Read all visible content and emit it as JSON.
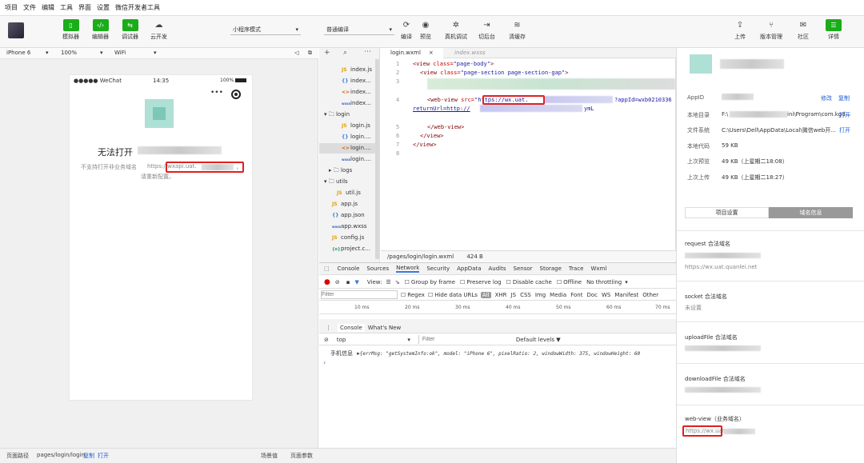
{
  "menu": [
    "项目",
    "文件",
    "编辑",
    "工具",
    "界面",
    "设置",
    "微信开发者工具"
  ],
  "toolbar": {
    "simulator": "模拟器",
    "editor": "编辑器",
    "debugger": "调试器",
    "cloud": "云开发",
    "mode_select": "小程序模式",
    "compile_select": "普通编译",
    "compile": "编译",
    "preview": "预览",
    "real_debug": "真机调试",
    "background": "切后台",
    "clear_cache": "清缓存",
    "upload": "上传",
    "version": "版本管理",
    "community": "社区",
    "details": "详情"
  },
  "simbar": {
    "device": "iPhone 6",
    "zoom": "100%",
    "network": "WiFi"
  },
  "phone": {
    "carrier": "●●●●● WeChat",
    "time": "14:35",
    "battery": "100%",
    "more": "•••",
    "error_title": "无法打开",
    "error_msg": "不支持打开非业务域名",
    "error_url": "https://wxapi.uat.",
    "error_suffix": "，",
    "error_tail": "请重新配置。"
  },
  "tree": {
    "items": [
      {
        "icon": "JS",
        "label": "index.js"
      },
      {
        "icon": "{}",
        "label": "index..."
      },
      {
        "icon": "<>",
        "label": "index..."
      },
      {
        "icon": "wxss",
        "label": "index..."
      },
      {
        "icon": "folder",
        "label": "login"
      },
      {
        "icon": "JS",
        "label": "login.js"
      },
      {
        "icon": "{}",
        "label": "login...."
      },
      {
        "icon": "<>",
        "label": "login...."
      },
      {
        "icon": "wxss",
        "label": "login...."
      },
      {
        "icon": "folder",
        "label": "logs"
      },
      {
        "icon": "folder",
        "label": "utils"
      },
      {
        "icon": "JS",
        "label": "util.js"
      },
      {
        "icon": "JS",
        "label": "app.js"
      },
      {
        "icon": "{}",
        "label": "app.json"
      },
      {
        "icon": "wxss",
        "label": "app.wxss"
      },
      {
        "icon": "JS",
        "label": "config.js"
      },
      {
        "icon": "{o}",
        "label": "project.c..."
      }
    ]
  },
  "editor": {
    "tab1": "login.wxml",
    "tab2": "index.wxss",
    "line1a": "<view ",
    "line1b": "class=",
    "line1c": "\"page-body\"",
    "line1d": ">",
    "line2a": "<view ",
    "line2b": "class=",
    "line2c": "\"page-section page-section-gap\"",
    "line2d": ">",
    "line4a": "<web-view ",
    "line4b": "src=",
    "line4c": "\"https://wx.uat.",
    "line4d": "?appId=wxb0210336",
    "line4e": "returnUrl=http://",
    "line4f": "ymL",
    "line6": "</web-view>",
    "line7": "</view>",
    "line8": "</view>",
    "path": "/pages/login/login.wxml",
    "size": "424 B"
  },
  "devtools": {
    "tabs": [
      "Console",
      "Sources",
      "Network",
      "Security",
      "AppData",
      "Audits",
      "Sensor",
      "Storage",
      "Trace",
      "Wxml"
    ],
    "view": "View:",
    "group": "Group by frame",
    "preserve": "Preserve log",
    "disable_cache": "Disable cache",
    "offline": "Offline",
    "throttle": "No throttling",
    "filter_placeholder": "Filter",
    "regex": "Regex",
    "hide_data": "Hide data URLs",
    "all": "All",
    "types": [
      "XHR",
      "JS",
      "CSS",
      "Img",
      "Media",
      "Font",
      "Doc",
      "WS",
      "Manifest",
      "Other"
    ],
    "timeline": [
      "10 ms",
      "20 ms",
      "30 ms",
      "40 ms",
      "50 ms",
      "60 ms",
      "70 ms"
    ],
    "console_tab": "Console",
    "whatsnew_tab": "What's New",
    "context": "top",
    "filter2": "Filter",
    "levels": "Default levels ▼",
    "log_label": "手机信息",
    "log_text": "{errMsg: \"getSystemInfo:ok\", model: \"iPhone 6\", pixelRatio: 2, windowWidth: 375, windowHeight: 60"
  },
  "right": {
    "appid_label": "AppID",
    "modify": "修改",
    "copy": "复制",
    "dir_label": "本地目录",
    "dir_val": "F:\\",
    "dir_val2": "ini\\Program\\com.kgd...",
    "open": "打开",
    "fs_label": "文件系统",
    "fs_val": "C:\\Users\\Dell\\AppData\\Local\\微信web开...",
    "open2": "打开",
    "code_label": "本地代码",
    "code_val": "59 KB",
    "preview_label": "上次预览",
    "preview_val": "49 KB（上星期二18:08）",
    "upload_label": "上次上传",
    "upload_val": "49 KB（上星期二18:27）",
    "tab_project": "项目设置",
    "tab_domain": "域名信息",
    "request_label": "request 合法域名",
    "request_val": "https://wx.uat.quanlei.net",
    "socket_label": "socket 合法域名",
    "socket_val": "未设置",
    "uploadfile_label": "uploadFile 合法域名",
    "downloadfile_label": "downloadFile 合法域名",
    "webview_label": "web-view（业务域名）",
    "webview_val": "https://wx.uat."
  },
  "bottom": {
    "path_label": "页面路径",
    "path": "pages/login/login",
    "copy": "复制",
    "open": "打开",
    "scene": "场景值",
    "params": "页面参数"
  },
  "colors": {
    "accent": "#1aad19",
    "highlight": "#e02020",
    "link": "#1a5bd6"
  }
}
